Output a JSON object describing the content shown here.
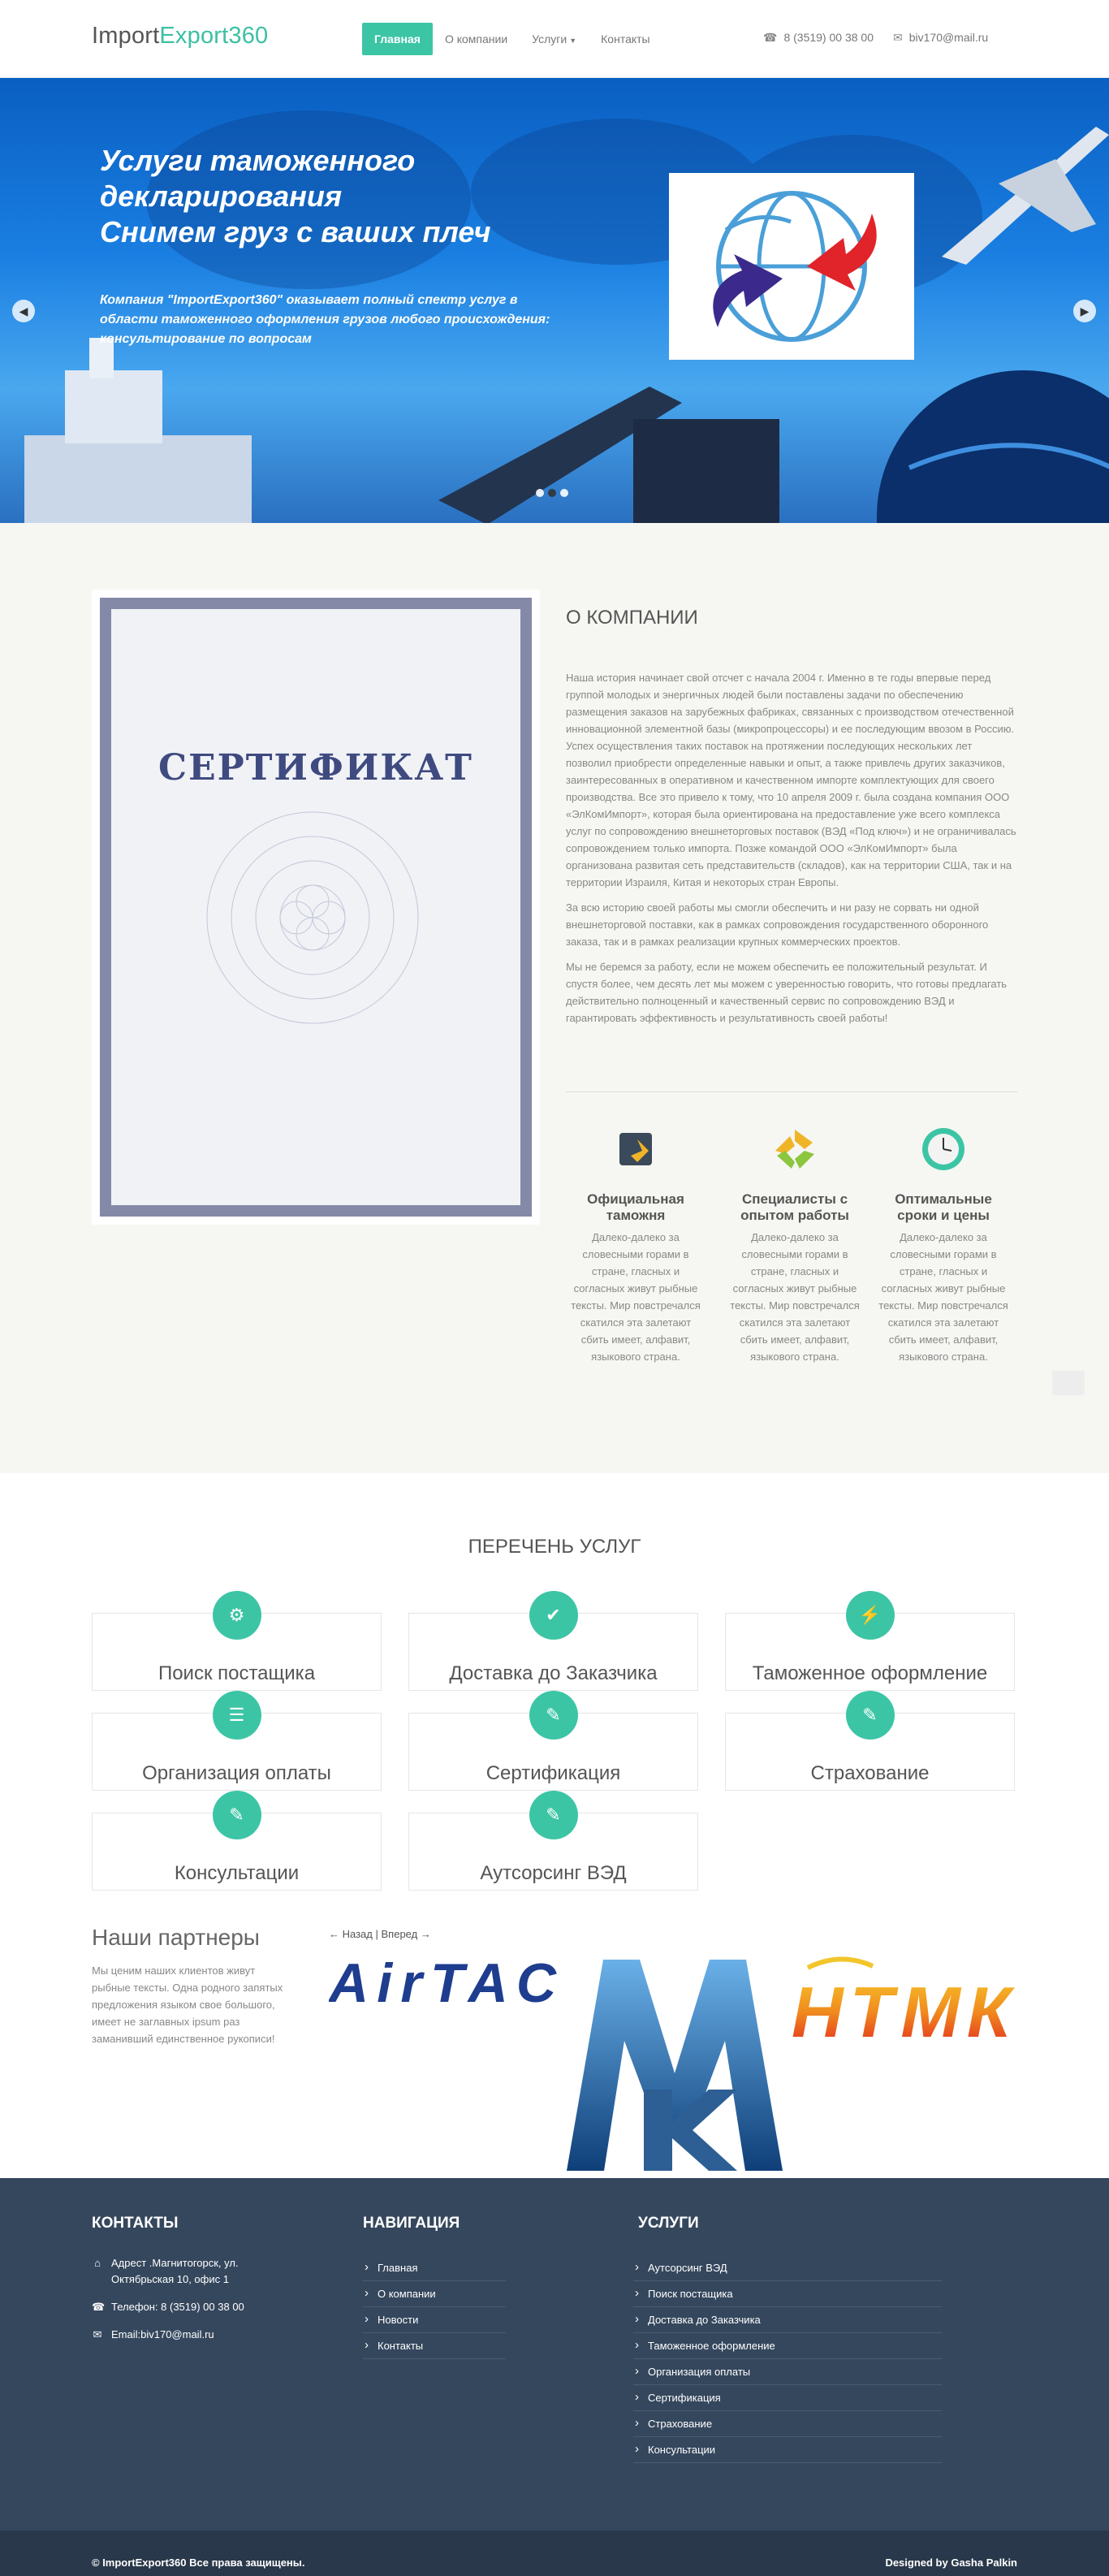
{
  "header": {
    "logo_part1": "Import",
    "logo_part2": "Export360",
    "nav": [
      "Главная",
      "О компании",
      "Услуги",
      "Контакты"
    ],
    "phone": "8 (3519) 00 38 00",
    "email": "biv170@mail.ru"
  },
  "hero": {
    "title": "Услуги таможенного\nдекларирования\nСнимем груз с ваших плеч",
    "text": "Компания \"ImportExport360\" оказывает полный спектр услуг в области таможенного оформления грузов любого происхождения: консультирование по вопросам"
  },
  "about": {
    "cert_title": "СЕРТИФИКАТ",
    "heading": "О КОМПАНИИ",
    "p1": "Наша история начинает свой отсчет с начала 2004 г. Именно в те годы впервые перед группой молодых и энергичных людей были поставлены задачи по обеспечению размещения заказов на зарубежных фабриках, связанных с производством отечественной инновационной элементной базы (микропроцессоры) и ее последующим ввозом в Россию.",
    "p2": "Успех осуществления таких поставок на протяжении последующих нескольких лет позволил приобрести определенные навыки и опыт, а также привлечь других заказчиков, заинтересованных в оперативном и качественном импорте комплектующих для своего производства. Все это привело к тому, что 10 апреля 2009 г. была создана компания ООО «ЭлКомИмпорт», которая была ориентирована на предоставление уже всего комплекса услуг по сопровождению внешнеторговых поставок (ВЭД «Под ключ») и не ограничивалась сопровождением только импорта. Позже командой ООО «ЭлКомИмпорт» была организована развитая сеть представительств (складов), как на территории США, так и на территории Израиля, Китая и некоторых стран Европы.",
    "p3": "За всю историю своей работы мы смогли обеспечить и ни разу не сорвать ни одной внешнеторговой поставки, как в рамках сопровождения государственного оборонного заказа, так и в рамках реализации крупных коммерческих проектов.",
    "p4": "Мы не беремся за работу, если не можем обеспечить ее положительный результат. И спустя более, чем десять лет мы можем с уверенностью говорить, что готовы предлагать действительно полноценный и качественный сервис по сопровождению ВЭД и гарантировать эффективность и результативность своей работы!",
    "features": [
      {
        "title": "Официальная таможня",
        "icon": "document-stamp-icon",
        "text": "Далеко-далеко за словесными горами в стране, гласных и согласных живут рыбные тексты. Мир повстречался скатился эта залетают сбить имеет, алфавит, языкового страна."
      },
      {
        "title": "Специалисты с опытом работы",
        "icon": "recycle-icon",
        "text": "Далеко-далеко за словесными горами в стране, гласных и согласных живут рыбные тексты. Мир повстречался скатился эта залетают сбить имеет, алфавит, языкового страна."
      },
      {
        "title": "Оптимальные сроки и цены",
        "icon": "clock-icon",
        "text": "Далеко-далеко за словесными горами в стране, гласных и согласных живут рыбные тексты. Мир повстречался скатился эта залетают сбить имеет, алфавит, языкового страна."
      }
    ]
  },
  "services": {
    "heading": "ПЕРЕЧЕНЬ УСЛУГ",
    "items": [
      {
        "label": "Поиск постащика",
        "icon": "gear-icon"
      },
      {
        "label": "Доставка до Заказчика",
        "icon": "check-icon"
      },
      {
        "label": "Таможенное оформление",
        "icon": "bolt-icon"
      },
      {
        "label": "Организация оплаты",
        "icon": "list-icon"
      },
      {
        "label": "Сертификация",
        "icon": "pencil-icon"
      },
      {
        "label": "Страхование",
        "icon": "pencil-icon"
      },
      {
        "label": "Консультации",
        "icon": "pencil-icon"
      },
      {
        "label": "Аутсорсинг ВЭД",
        "icon": "pencil-icon"
      }
    ]
  },
  "partners": {
    "heading": "Наши партнеры",
    "text": "Мы ценим наших клиентов живут рыбные тексты. Одна родного запятых предложения языком свое большого, имеет не заглавных ipsum раз заманивший единственное рукописи!",
    "prev": "← Назад",
    "sep": "|",
    "next": "Вперед →",
    "logo1": "AirTAC",
    "logo3": "НТМК"
  },
  "footer": {
    "contacts_heading": "КОНТАКТЫ",
    "address": "Адрест .Магнитогорск, ул. Октябрьская 10, офис 1",
    "phone": "Телефон: 8 (3519) 00 38 00",
    "email": "Email:biv170@mail.ru",
    "nav_heading": "НАВИГАЦИЯ",
    "nav": [
      "Главная",
      "О компании",
      "Новости",
      "Контакты"
    ],
    "services_heading": "УСЛУГИ",
    "services": [
      "Аутсорсинг ВЭД",
      "Поиск постащика",
      "Доставка до Заказчика",
      "Таможенное оформление",
      "Организация оплаты",
      "Сертификация",
      "Страхование",
      "Консультации"
    ]
  },
  "copyright": {
    "left": "© ImportExport360 Все права защищены.",
    "right": "Designed by Gasha Palkin"
  },
  "colors": {
    "accent": "#3cc5a5",
    "footer": "#35475d",
    "copyright": "#29384a",
    "about_bg": "#f6f7f2"
  }
}
